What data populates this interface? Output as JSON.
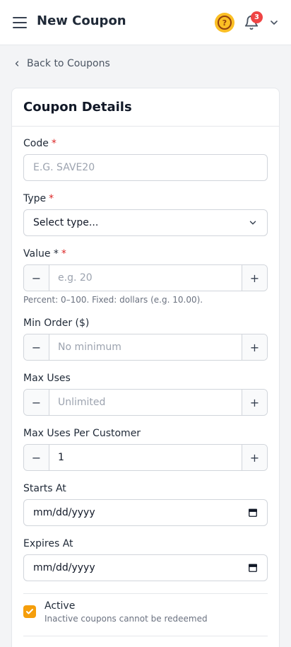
{
  "header": {
    "title": "New Coupon",
    "notification_count": "3",
    "icons": [
      "menu-icon",
      "help-icon",
      "bell-icon",
      "chevron-down-icon"
    ],
    "colors": {
      "help": "#fbbf24",
      "badge": "#ef4444"
    }
  },
  "nav": {
    "back_label": "Back to Coupons"
  },
  "form": {
    "title": "Coupon Details",
    "code": {
      "label": "Code",
      "required_mark": "*",
      "placeholder": "E.G. SAVE20"
    },
    "type": {
      "label": "Type",
      "required_mark": "*",
      "selected": "Select type..."
    },
    "value": {
      "label": "Value *",
      "required_mark": "*",
      "placeholder": "e.g. 20",
      "help": "Percent: 0–100. Fixed: dollars (e.g. 10.00).",
      "minus": "−",
      "plus": "+"
    },
    "min_order": {
      "label": "Min Order ($)",
      "placeholder": "No minimum",
      "minus": "−",
      "plus": "+"
    },
    "max_uses": {
      "label": "Max Uses",
      "placeholder": "Unlimited",
      "minus": "−",
      "plus": "+"
    },
    "max_uses_per_customer": {
      "label": "Max Uses Per Customer",
      "value": "1",
      "minus": "−",
      "plus": "+"
    },
    "starts_at": {
      "label": "Starts At",
      "value": "mm/dd/yyyy"
    },
    "expires_at": {
      "label": "Expires At",
      "value": "mm/dd/yyyy"
    },
    "active": {
      "label": "Active",
      "description": "Inactive coupons cannot be redeemed",
      "checked": true,
      "color": "#f59e0b"
    }
  }
}
